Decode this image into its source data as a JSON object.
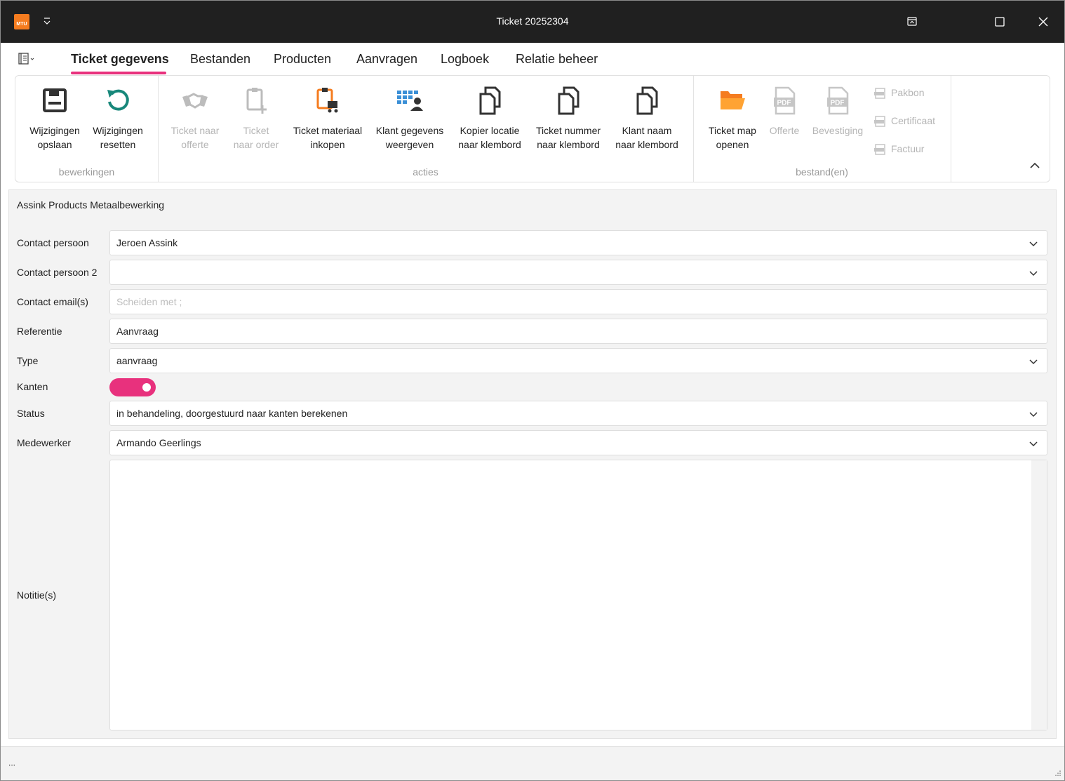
{
  "window": {
    "title": "Ticket 20252304",
    "logo_text": "MTU"
  },
  "tabs": [
    {
      "label": "Ticket gegevens",
      "active": true
    },
    {
      "label": "Bestanden"
    },
    {
      "label": "Producten"
    },
    {
      "label": "Aanvragen"
    },
    {
      "label": "Logboek"
    },
    {
      "label": "Relatie beheer"
    }
  ],
  "ribbon": {
    "groups": {
      "bewerkingen": "bewerkingen",
      "acties": "acties",
      "bestanden": "bestand(en)"
    },
    "save": [
      "Wijzigingen",
      "opslaan"
    ],
    "reset": [
      "Wijzigingen",
      "resetten"
    ],
    "to_offerte": [
      "Ticket naar",
      "offerte"
    ],
    "to_order": [
      "Ticket",
      "naar order"
    ],
    "materiaal": [
      "Ticket materiaal",
      "inkopen"
    ],
    "klant_gegevens": [
      "Klant gegevens",
      "weergeven"
    ],
    "kopier_locatie": [
      "Kopier locatie",
      "naar klembord"
    ],
    "ticket_nummer": [
      "Ticket nummer",
      "naar klembord"
    ],
    "klant_naam": [
      "Klant naam",
      "naar klembord"
    ],
    "map_openen": [
      "Ticket map",
      "openen"
    ],
    "offerte": "Offerte",
    "bevestiging": "Bevestiging",
    "pakbon": "Pakbon",
    "certificaat": "Certificaat",
    "factuur": "Factuur",
    "pdf_text": "PDF"
  },
  "form": {
    "company": "Assink Products Metaalbewerking",
    "contact": {
      "label": "Contact persoon",
      "value": "Jeroen Assink"
    },
    "contact2": {
      "label": "Contact persoon 2",
      "value": ""
    },
    "email": {
      "label": "Contact email(s)",
      "placeholder": "Scheiden met ;"
    },
    "referentie": {
      "label": "Referentie",
      "value": "Aanvraag"
    },
    "type": {
      "label": "Type",
      "value": "aanvraag"
    },
    "kanten": {
      "label": "Kanten",
      "on": true
    },
    "status": {
      "label": "Status",
      "value": "in behandeling, doorgestuurd naar kanten berekenen"
    },
    "medewerker": {
      "label": "Medewerker",
      "value": "Armando Geerlings"
    },
    "notities": {
      "label": "Notitie(s)",
      "value": ""
    }
  },
  "statusbar": {
    "text": "..."
  },
  "colors": {
    "accent": "#e8317d",
    "titlebar": "#202020",
    "orange": "#f57c1f",
    "teal": "#17877a",
    "blue": "#3a8fd6"
  }
}
